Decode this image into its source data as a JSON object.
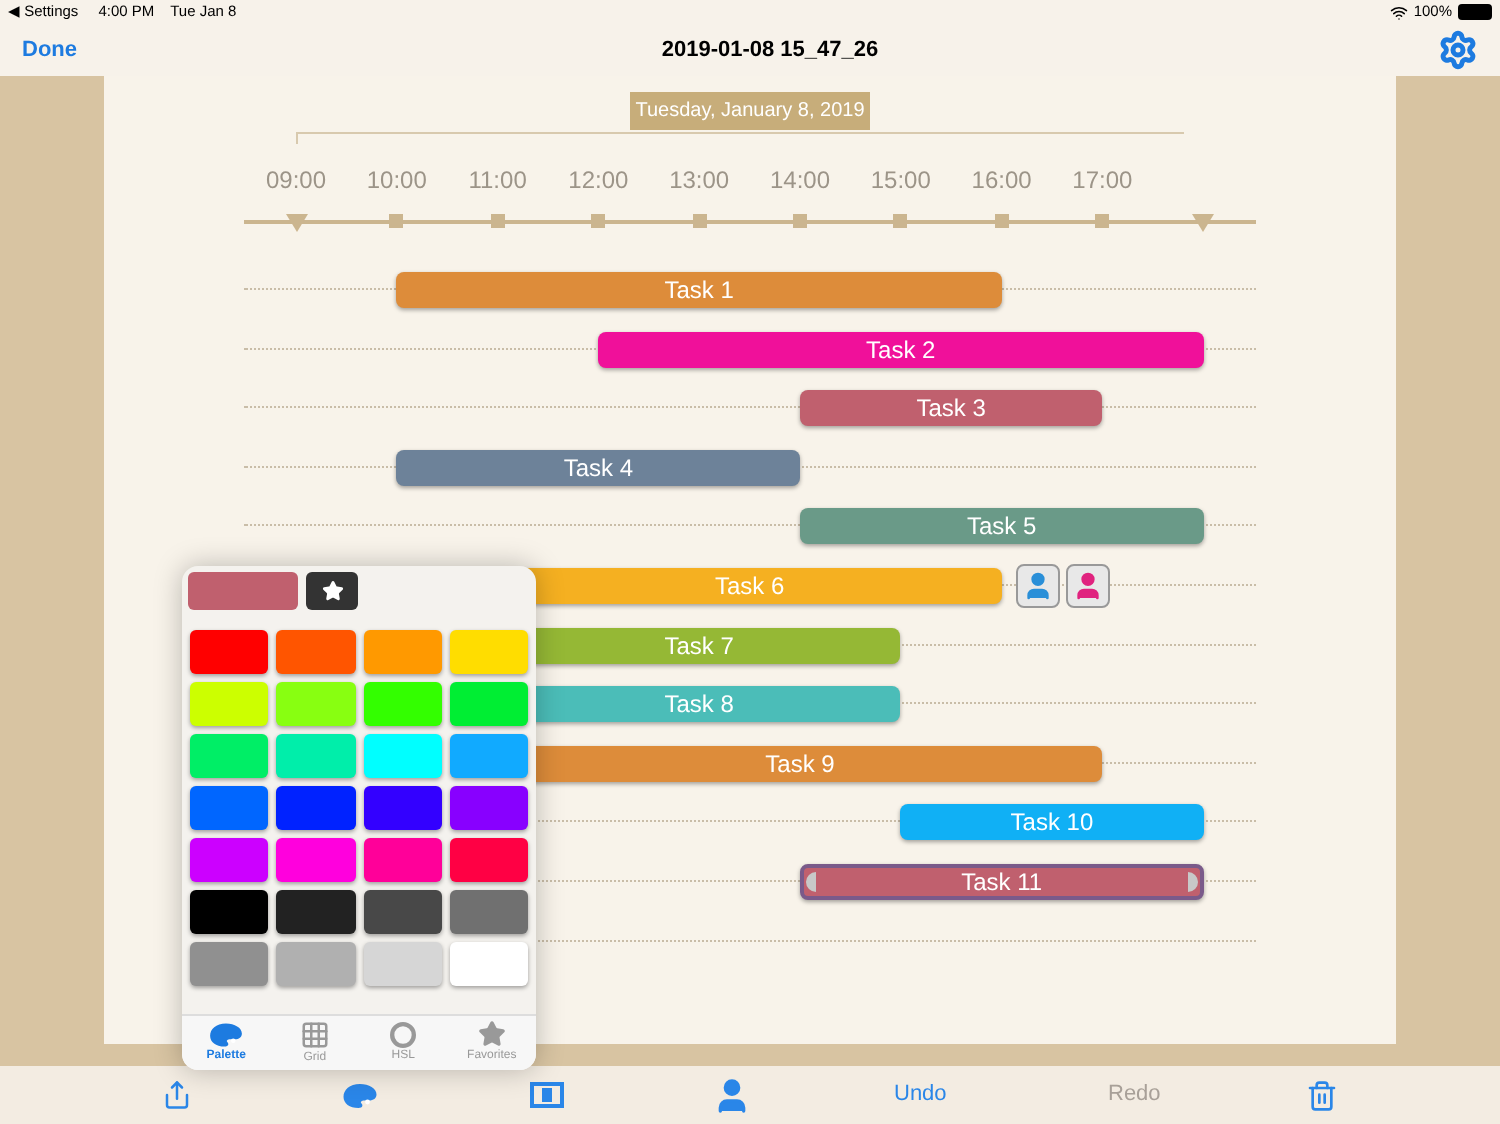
{
  "status_bar": {
    "back": "◀ Settings",
    "time": "4:00 PM",
    "date": "Tue Jan 8",
    "battery": "100%"
  },
  "nav": {
    "done": "Done",
    "title": "2019-01-08 15_47_26"
  },
  "timeline": {
    "date": "Tuesday, January 8, 2019",
    "hours": [
      "09:00",
      "10:00",
      "11:00",
      "12:00",
      "13:00",
      "14:00",
      "15:00",
      "16:00",
      "17:00"
    ]
  },
  "tasks": [
    {
      "name": "Task 1",
      "color": "#dd8c3a",
      "selected": false
    },
    {
      "name": "Task 2",
      "color": "#f0109a",
      "selected": false
    },
    {
      "name": "Task 3",
      "color": "#c0606e",
      "selected": false
    },
    {
      "name": "Task 4",
      "color": "#6d8299",
      "selected": false
    },
    {
      "name": "Task 5",
      "color": "#6a9a88",
      "selected": false
    },
    {
      "name": "Task 6",
      "color": "#f5b021",
      "selected": false,
      "assignees": [
        {
          "color": "#2a8fd8"
        },
        {
          "color": "#e0237f"
        }
      ]
    },
    {
      "name": "Task 7",
      "color": "#95b835",
      "selected": false
    },
    {
      "name": "Task 8",
      "color": "#4bbdb8",
      "selected": false
    },
    {
      "name": "Task 9",
      "color": "#dd8c3a",
      "selected": false
    },
    {
      "name": "Task 10",
      "color": "#10b0f5",
      "selected": false
    },
    {
      "name": "Task 11",
      "color": "#c0606e",
      "selected": true
    }
  ],
  "popover": {
    "current": {
      "color": "#c0606e"
    },
    "swatches": [
      {
        "color": "#ff0000"
      },
      {
        "color": "#ff5500"
      },
      {
        "color": "#ff9900"
      },
      {
        "color": "#ffdd00"
      },
      {
        "color": "#ccff00"
      },
      {
        "color": "#88ff11"
      },
      {
        "color": "#33ff00"
      },
      {
        "color": "#00ee33"
      },
      {
        "color": "#00ee66"
      },
      {
        "color": "#00eeaa"
      },
      {
        "color": "#00ffff"
      },
      {
        "color": "#11aaff"
      },
      {
        "color": "#0066ff"
      },
      {
        "color": "#0022ff"
      },
      {
        "color": "#3300ff"
      },
      {
        "color": "#8800ff"
      },
      {
        "color": "#cc00ff"
      },
      {
        "color": "#ff00dd"
      },
      {
        "color": "#ff0099"
      },
      {
        "color": "#ff0044"
      },
      {
        "color": "#000000"
      },
      {
        "color": "#222222"
      },
      {
        "color": "#484848"
      },
      {
        "color": "#707070"
      },
      {
        "color": "#909090"
      },
      {
        "color": "#b0b0b0"
      },
      {
        "color": "#d6d6d6"
      },
      {
        "color": "#ffffff"
      }
    ],
    "tabs": [
      {
        "label": "Palette",
        "selected": true
      },
      {
        "label": "Grid",
        "selected": false
      },
      {
        "label": "HSL",
        "selected": false
      },
      {
        "label": "Favorites",
        "selected": false
      }
    ]
  },
  "toolbar": {
    "undo": {
      "label": "Undo",
      "disabled": false
    },
    "redo": {
      "label": "Redo",
      "disabled": true
    }
  }
}
